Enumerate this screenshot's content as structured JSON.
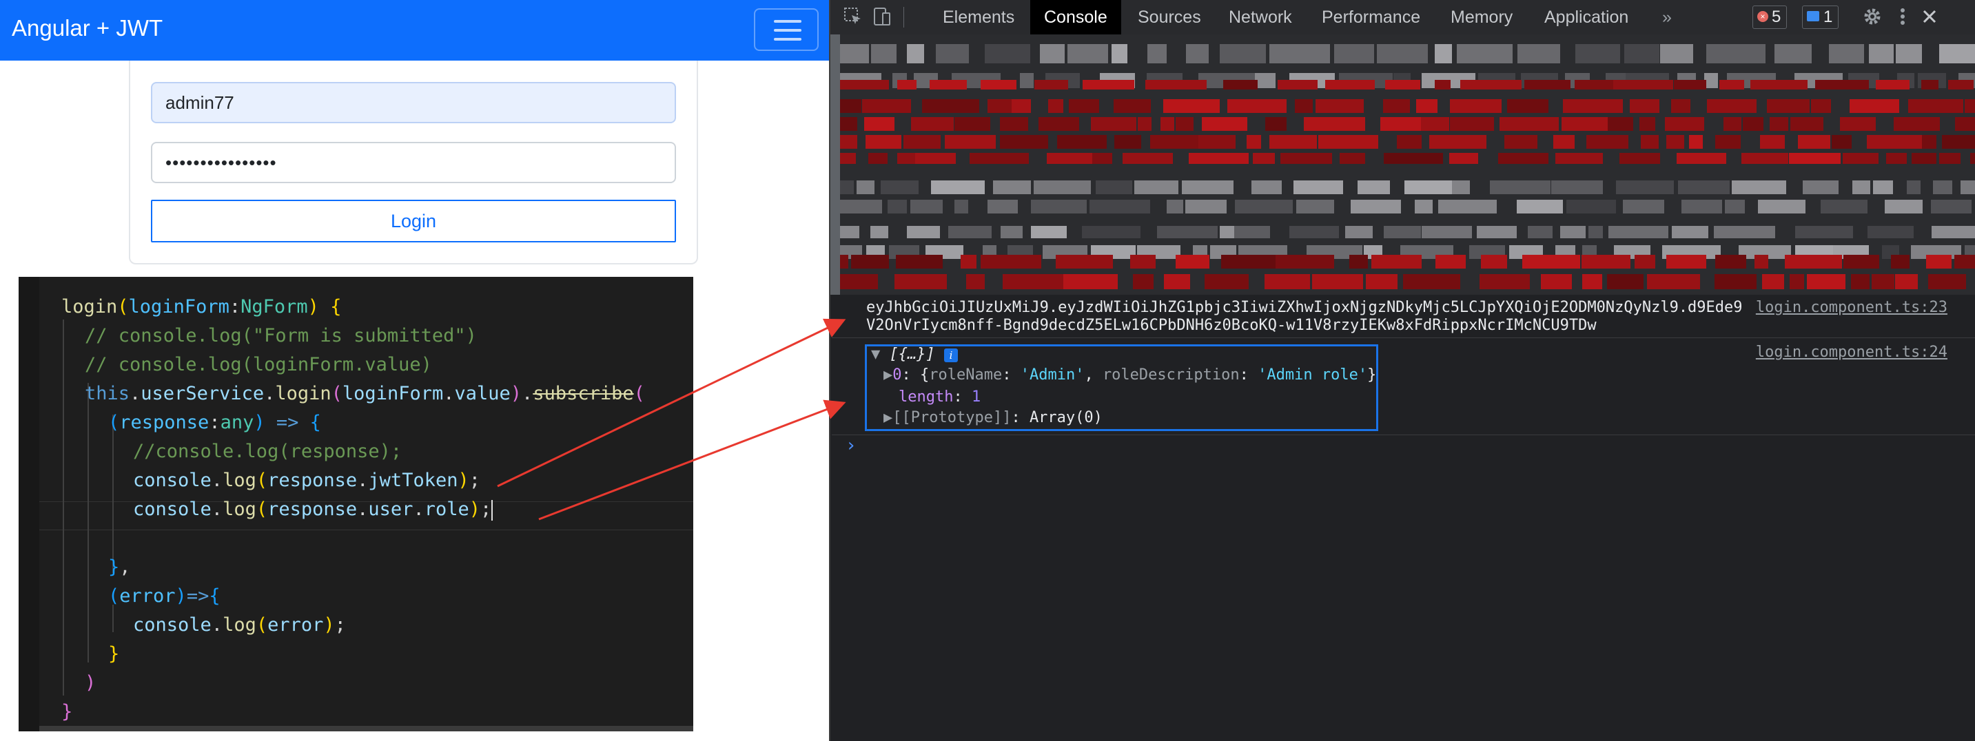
{
  "app": {
    "brand": "Angular + JWT",
    "login_form": {
      "username_value": "admin77",
      "password_value": "••••••••••••••••",
      "login_label": "Login"
    }
  },
  "editor": {
    "lines": [
      [
        [
          "fn",
          "login"
        ],
        [
          "brk",
          "("
        ],
        [
          "par",
          "loginForm"
        ],
        [
          "plain",
          ":"
        ],
        [
          "typ",
          "NgForm"
        ],
        [
          "brk",
          ")"
        ],
        [
          "plain",
          " "
        ],
        [
          "brk",
          "{"
        ]
      ],
      [
        [
          "cmt",
          "// console.log(\"Form is submitted\")"
        ]
      ],
      [
        [
          "cmt",
          "// console.log(loginForm.value)"
        ]
      ],
      [
        [
          "kw",
          "this"
        ],
        [
          "plain",
          "."
        ],
        [
          "prop",
          "userService"
        ],
        [
          "plain",
          "."
        ],
        [
          "fn",
          "login"
        ],
        [
          "brk2",
          "("
        ],
        [
          "prop",
          "loginForm"
        ],
        [
          "plain",
          "."
        ],
        [
          "prop",
          "value"
        ],
        [
          "brk2",
          ")"
        ],
        [
          "plain",
          "."
        ],
        [
          "fnstrike",
          "subscribe"
        ],
        [
          "brk2",
          "("
        ]
      ],
      [
        [
          "brk3",
          "("
        ],
        [
          "par",
          "response"
        ],
        [
          "plain",
          ":"
        ],
        [
          "typ",
          "any"
        ],
        [
          "brk3",
          ")"
        ],
        [
          "plain",
          " "
        ],
        [
          "kw",
          "=>"
        ],
        [
          "plain",
          " "
        ],
        [
          "brk3",
          "{"
        ]
      ],
      [
        [
          "cmt",
          "//console.log(response);"
        ]
      ],
      [
        [
          "prop",
          "console"
        ],
        [
          "plain",
          "."
        ],
        [
          "fn",
          "log"
        ],
        [
          "brk",
          "("
        ],
        [
          "prop",
          "response"
        ],
        [
          "plain",
          "."
        ],
        [
          "prop",
          "jwtToken"
        ],
        [
          "brk",
          ")"
        ],
        [
          "plain",
          ";"
        ]
      ],
      [
        [
          "prop",
          "console"
        ],
        [
          "plain",
          "."
        ],
        [
          "fn",
          "log"
        ],
        [
          "brk",
          "("
        ],
        [
          "prop",
          "response"
        ],
        [
          "plain",
          "."
        ],
        [
          "prop",
          "user"
        ],
        [
          "plain",
          "."
        ],
        [
          "prop",
          "role"
        ],
        [
          "brk",
          ")"
        ],
        [
          "plain",
          ";"
        ],
        [
          "caret",
          ""
        ]
      ],
      [
        [
          "plain",
          ""
        ]
      ],
      [
        [
          "brk3",
          "}"
        ],
        [
          "plain",
          ","
        ]
      ],
      [
        [
          "brk3",
          "("
        ],
        [
          "par",
          "error"
        ],
        [
          "brk3",
          ")"
        ],
        [
          "kw",
          "=>"
        ],
        [
          "brk3",
          "{"
        ]
      ],
      [
        [
          "prop",
          "console"
        ],
        [
          "plain",
          "."
        ],
        [
          "fn",
          "log"
        ],
        [
          "brk",
          "("
        ],
        [
          "prop",
          "error"
        ],
        [
          "brk",
          ")"
        ],
        [
          "plain",
          ";"
        ]
      ],
      [
        [
          "brk",
          "}"
        ]
      ],
      [
        [
          "brk2",
          ")"
        ]
      ],
      [
        [
          "brk2",
          "}"
        ]
      ]
    ]
  },
  "devtools": {
    "tabs": [
      "Elements",
      "Console",
      "Sources",
      "Network",
      "Performance",
      "Memory",
      "Application"
    ],
    "active_tab": "Console",
    "more_tabs_label": "»",
    "error_count": "5",
    "message_count": "1",
    "console": {
      "jwt_line1": "eyJhbGciOiJIUzUxMiJ9.eyJzdWIiOiJhZG1pbjc3IiwiZXhwIjoxNjgzNDkyMjc5LCJpYXQiOjE2ODM0NzQyNzl9.d9Ede9",
      "jwt_line2": "V2OnVrIycm8nff-Bgnd9decdZ5ELw16CPbDNH6z0BcoKQ-w11V8rzyIEKw8xFdRippxNcrIMcNCU9TDw",
      "jwt_source": "login.component.ts:23",
      "role_source": "login.component.ts:24",
      "array_summary": "[{…}]",
      "info_badge": "i",
      "item_index": "0",
      "role_key": "roleName",
      "role_value": "'Admin'",
      "desc_key": "roleDescription",
      "desc_value": "'Admin role'",
      "length_key": "length",
      "length_value": "1",
      "prototype_key": "[[Prototype]]",
      "prototype_value": "Array(0)",
      "prompt": "›"
    }
  },
  "colors": {
    "navbar": "#0d6efd",
    "annotation_arrow": "#e8392f",
    "highlight_box": "#1a73e8"
  }
}
